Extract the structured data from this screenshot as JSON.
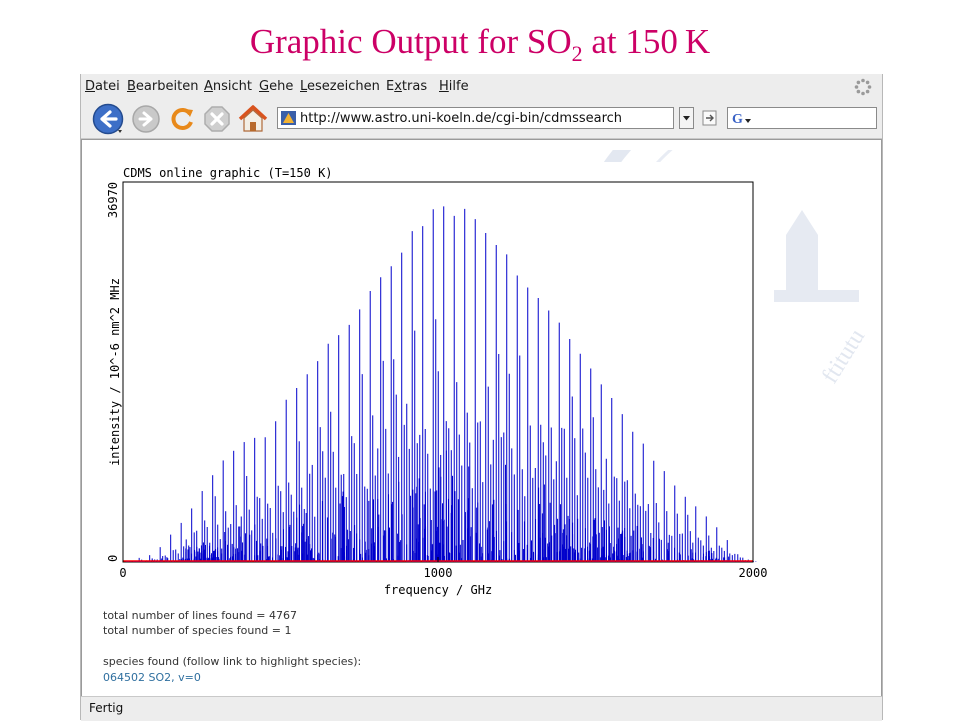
{
  "slide": {
    "title_main": "Graphic Output for SO",
    "title_sub": "2",
    "title_tail": " at 150 K"
  },
  "browser": {
    "menu": [
      {
        "label": "Datei",
        "key": "D",
        "rest": "atei"
      },
      {
        "label": "Bearbeiten",
        "key": "B",
        "rest": "earbeiten"
      },
      {
        "label": "Ansicht",
        "key": "A",
        "rest": "nsicht"
      },
      {
        "label": "Gehe",
        "key": "G",
        "rest": "ehe"
      },
      {
        "label": "Lesezeichen",
        "key": "L",
        "rest": "esezeichen"
      },
      {
        "label": "Extras",
        "key": "x",
        "rest": "tras"
      },
      {
        "label": "Hilfe",
        "key": "H",
        "rest": "ilfe"
      }
    ],
    "toolbar_icons": [
      "back-icon",
      "forward-icon",
      "reload-icon",
      "stop-icon",
      "home-icon"
    ],
    "url": "http://www.astro.uni-koeln.de/cgi-bin/cdmssearch",
    "search_engine_letter": "G",
    "status": "Fertig"
  },
  "page": {
    "total_lines_text": "total number of lines found = 4767",
    "total_species_text": "total number of species found = 1",
    "species_heading": "species found (follow link to highlight species):",
    "species_link": "064502 SO2, v=0"
  },
  "colors": {
    "title": "#cc0066",
    "spectrum": "#0000cc",
    "baseline": "#ff0000",
    "link": "#2f6f9f"
  },
  "chart_data": {
    "type": "line",
    "title": "CDMS online graphic (T=150 K)",
    "xlabel": "frequency / GHz",
    "ylabel": "intensity / 10^-6 nm^2 MHz",
    "x_ticks": [
      0,
      1000,
      2000
    ],
    "y_ticks": [
      0,
      36970
    ],
    "xlim": [
      0,
      2000
    ],
    "ylim": [
      0,
      36970
    ],
    "total_lines": 4767,
    "series": [
      {
        "color": "#0000cc",
        "style": "stick spectrum",
        "envelope_x_ghz": [
          0,
          100,
          200,
          300,
          380,
          450,
          500,
          600,
          700,
          800,
          900,
          1000,
          1100,
          1200,
          1300,
          1400,
          1500,
          1600,
          1700,
          1800,
          1900,
          1950,
          2000
        ],
        "envelope_y": [
          0,
          800,
          4500,
          9500,
          12000,
          12500,
          15000,
          19500,
          23000,
          27500,
          32000,
          35500,
          34500,
          31000,
          27000,
          23000,
          18500,
          14000,
          9500,
          6000,
          3000,
          800,
          0
        ]
      }
    ]
  }
}
